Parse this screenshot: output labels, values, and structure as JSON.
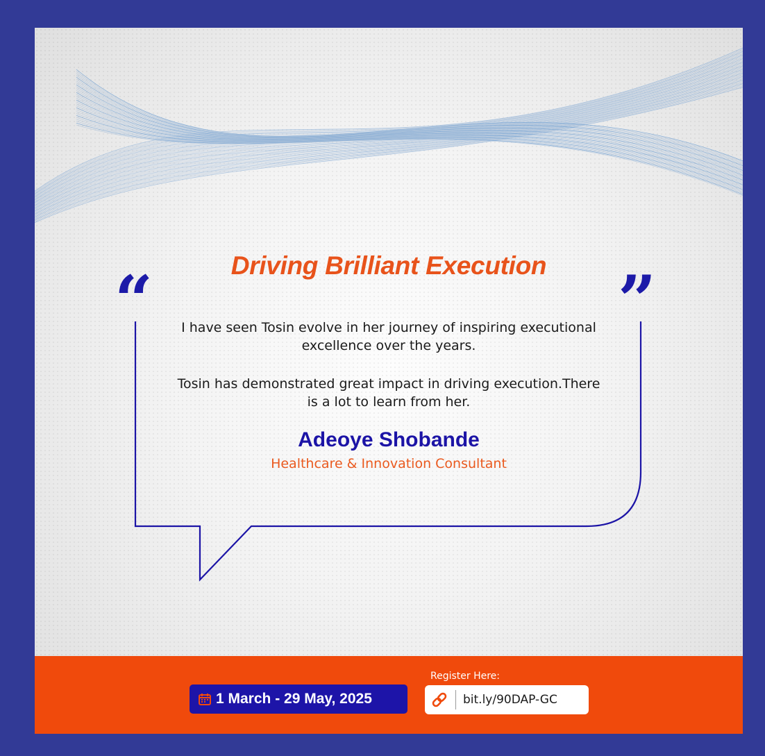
{
  "colors": {
    "frame": "#323a96",
    "accent_orange": "#f04a0c",
    "accent_blue": "#1c14a6",
    "white": "#ffffff"
  },
  "headline": "Driving Brilliant Execution",
  "quote": {
    "open_mark": "“",
    "close_mark": "”",
    "paragraph_1": "I have seen Tosin evolve in her journey of inspiring executional excellence over the years.",
    "paragraph_2": "Tosin has demonstrated great impact in driving execution.There is a lot to learn from her."
  },
  "author": {
    "name": "Adeoye Shobande",
    "title": "Healthcare & Innovation Consultant"
  },
  "footer": {
    "date_icon": "calendar-icon",
    "date_text": "1 March - 29 May, 2025",
    "register_label": "Register Here:",
    "link_icon": "link-icon",
    "link_text": "bit.ly/90DAP-GC"
  }
}
